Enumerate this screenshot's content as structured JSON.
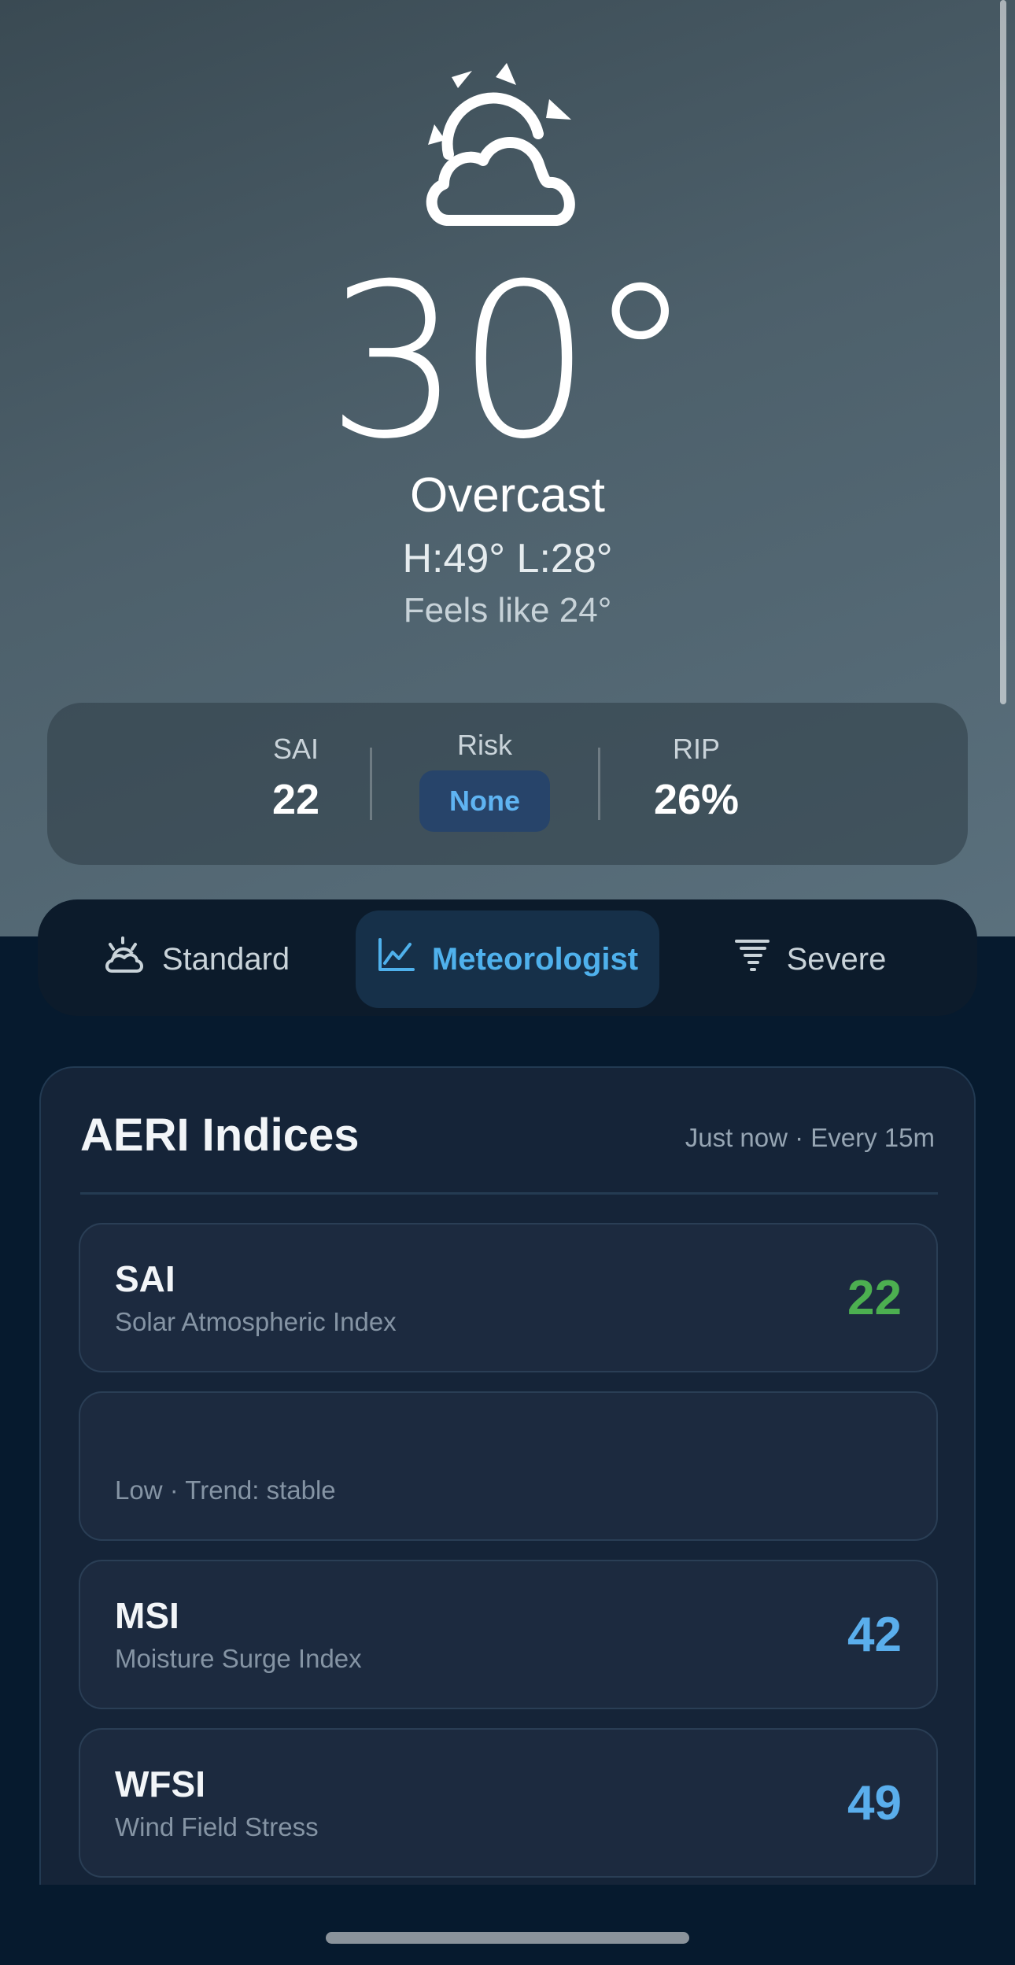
{
  "current": {
    "temperature": "30°",
    "condition": "Overcast",
    "high_low": "H:49° L:28°",
    "feels_like": "Feels like 24°",
    "icon": "partly-cloudy-sun-icon"
  },
  "summary": {
    "sai_label": "SAI",
    "sai_value": "22",
    "risk_label": "Risk",
    "risk_value": "None",
    "rip_label": "RIP",
    "rip_value": "26%"
  },
  "tabs": [
    {
      "label": "Standard",
      "icon": "partly-cloudy-icon",
      "active": false
    },
    {
      "label": "Meteorologist",
      "icon": "line-chart-icon",
      "active": true
    },
    {
      "label": "Severe",
      "icon": "tornado-icon",
      "active": false
    }
  ],
  "panel": {
    "title": "AERI Indices",
    "meta": "Just now · Every 15m",
    "rows": [
      {
        "abbr": "SAI",
        "desc": "Solar Atmospheric Index",
        "value": "22"
      },
      {
        "abbr": "",
        "desc": "Low · Trend: stable",
        "value": ""
      },
      {
        "abbr": "MSI",
        "desc": "Moisture Surge Index",
        "value": "42"
      },
      {
        "abbr": "WFSI",
        "desc": "Wind Field Stress",
        "value": "49"
      }
    ]
  },
  "colors": {
    "accent": "#4fb1ec",
    "value_green": "#4caf50",
    "value_blue": "#5aaeec"
  }
}
